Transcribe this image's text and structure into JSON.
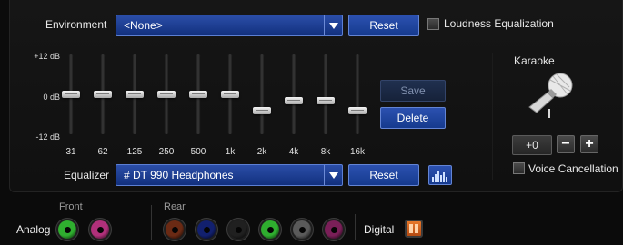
{
  "environment": {
    "label": "Environment",
    "selected": "<None>",
    "reset_label": "Reset",
    "loudness_label": "Loudness Equalization",
    "loudness_checked": false
  },
  "equalizer": {
    "db_labels": [
      "+12 dB",
      "0 dB",
      "-12 dB"
    ],
    "bands": [
      {
        "freq": "31",
        "gain_db": 0
      },
      {
        "freq": "62",
        "gain_db": 0
      },
      {
        "freq": "125",
        "gain_db": 0
      },
      {
        "freq": "250",
        "gain_db": 0
      },
      {
        "freq": "500",
        "gain_db": 0
      },
      {
        "freq": "1k",
        "gain_db": 0
      },
      {
        "freq": "2k",
        "gain_db": -5
      },
      {
        "freq": "4k",
        "gain_db": -2
      },
      {
        "freq": "8k",
        "gain_db": -2
      },
      {
        "freq": "16k",
        "gain_db": -5
      }
    ],
    "save_label": "Save",
    "delete_label": "Delete",
    "label": "Equalizer",
    "preset": "# DT 990 Headphones",
    "reset_label": "Reset"
  },
  "karaoke": {
    "label": "Karaoke",
    "value": "+0",
    "minus": "−",
    "plus": "+",
    "voice_cancel_label": "Voice Cancellation",
    "voice_cancel_checked": false
  },
  "jacks": {
    "analog_label": "Analog",
    "front_label": "Front",
    "rear_label": "Rear",
    "digital_label": "Digital",
    "front": [
      {
        "name": "green",
        "color": "#2fae2f"
      },
      {
        "name": "pink",
        "color": "#b0307a"
      }
    ],
    "rear": [
      {
        "name": "orange",
        "color": "#6a2a14"
      },
      {
        "name": "blue",
        "color": "#12206e"
      },
      {
        "name": "black",
        "color": "#202020"
      },
      {
        "name": "green",
        "color": "#2fae2f"
      },
      {
        "name": "gray",
        "color": "#5a5a5a"
      },
      {
        "name": "pink",
        "color": "#7a1f58"
      }
    ]
  }
}
